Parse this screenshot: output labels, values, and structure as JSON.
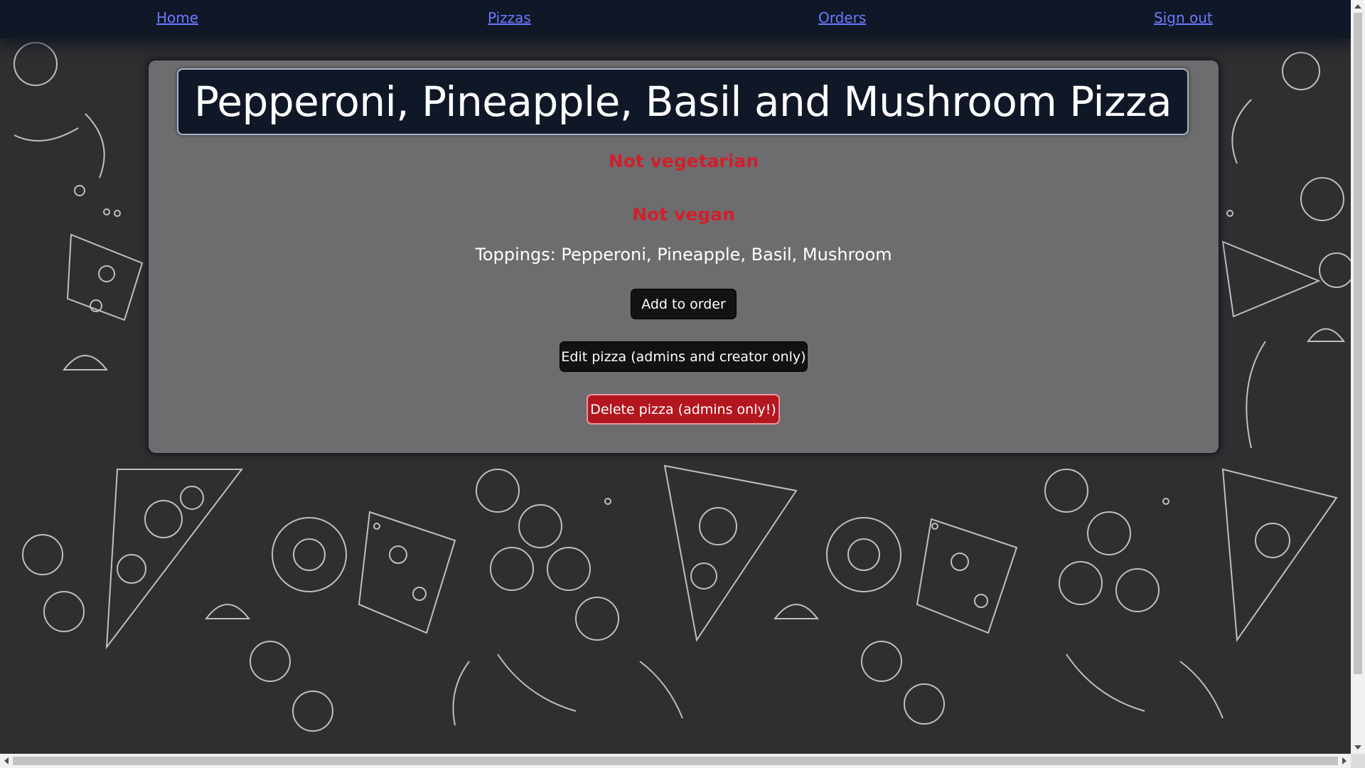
{
  "nav": {
    "items": [
      {
        "label": "Home"
      },
      {
        "label": "Pizzas"
      },
      {
        "label": "Orders"
      },
      {
        "label": "Sign out"
      }
    ]
  },
  "pizza": {
    "name": "Pepperoni, Pineapple, Basil and Mushroom Pizza",
    "vegetarian_status": "Not vegetarian",
    "vegan_status": "Not vegan",
    "toppings_label": "Toppings: Pepperoni, Pineapple, Basil, Mushroom"
  },
  "actions": {
    "add_label": "Add to order",
    "edit_label": "Edit pizza (admins and creator only)",
    "delete_label": "Delete pizza (admins only!)"
  },
  "colors": {
    "nav_background": "#101828",
    "link": "#6d78ff",
    "warning_text": "#d0202b",
    "delete_button": "#b3161f",
    "dark_button": "#121212"
  }
}
